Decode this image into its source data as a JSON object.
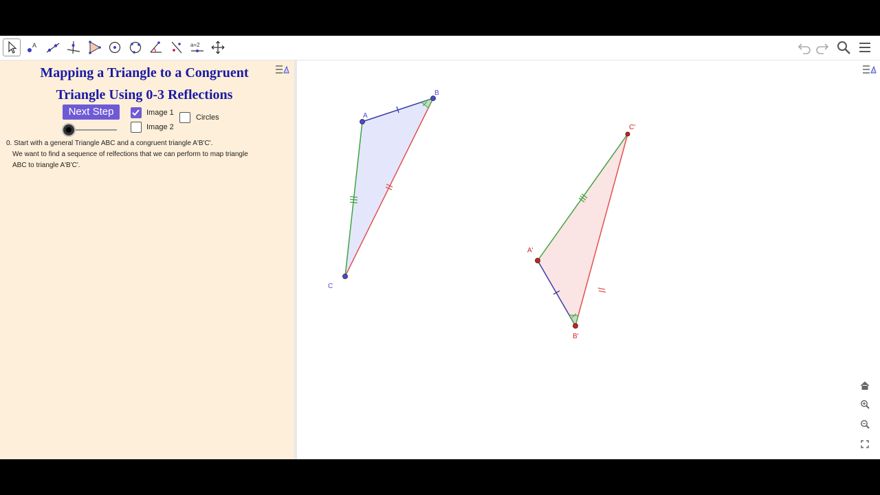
{
  "toolbar": {
    "tools": [
      {
        "name": "move-tool",
        "icon": "cursor-arrow-icon",
        "active": true
      },
      {
        "name": "point-tool",
        "icon": "point-a-icon",
        "label": "A"
      },
      {
        "name": "line-tool",
        "icon": "line-icon"
      },
      {
        "name": "perpendicular-line-tool",
        "icon": "perpendicular-icon"
      },
      {
        "name": "polygon-tool",
        "icon": "polygon-icon"
      },
      {
        "name": "circle-tool",
        "icon": "circle-center-icon"
      },
      {
        "name": "circle-three-points-tool",
        "icon": "circle-points-icon"
      },
      {
        "name": "angle-tool",
        "icon": "angle-icon"
      },
      {
        "name": "reflect-tool",
        "icon": "reflect-line-icon"
      },
      {
        "name": "slider-tool",
        "icon": "slider-icon",
        "label": "a=2"
      },
      {
        "name": "move-view-tool",
        "icon": "move-view-icon"
      }
    ],
    "right": [
      "undo-icon",
      "redo-icon",
      "search-icon",
      "menu-icon"
    ]
  },
  "algebra": {
    "title_line1": "Mapping a Triangle to a Congruent",
    "title_line2": "Triangle Using 0-3 Reflections",
    "next_step_label": "Next Step",
    "image1_label": "Image 1",
    "image1_checked": true,
    "image2_label": "Image 2",
    "image2_checked": false,
    "circles_label": "Circles",
    "circles_checked": false,
    "step_slider_value": 0,
    "step_line1": "0. Start with a general Triangle ABC and a congruent triangle A'B'C'.",
    "step_line2": "We want to find a sequence of relfections that we can perform to map triangle",
    "step_line3": "ABC to triangle A'B'C'."
  },
  "graphics": {
    "points": {
      "A": "A",
      "B": "B",
      "C": "C",
      "A1": "A'",
      "B1": "B'",
      "C1": "C'"
    },
    "colors": {
      "side_ab": "#3c3ca8",
      "side_ac": "#3fa33f",
      "side_bc": "#e05050",
      "fill_abc": "#dfe3fb",
      "fill_a1b1c1": "#fbe1e1",
      "point_abc": "#4a4ad0",
      "point_a1b1c1": "#d02020"
    }
  },
  "view_buttons": [
    "home-icon",
    "zoom-in-icon",
    "zoom-out-icon",
    "fullscreen-icon"
  ]
}
